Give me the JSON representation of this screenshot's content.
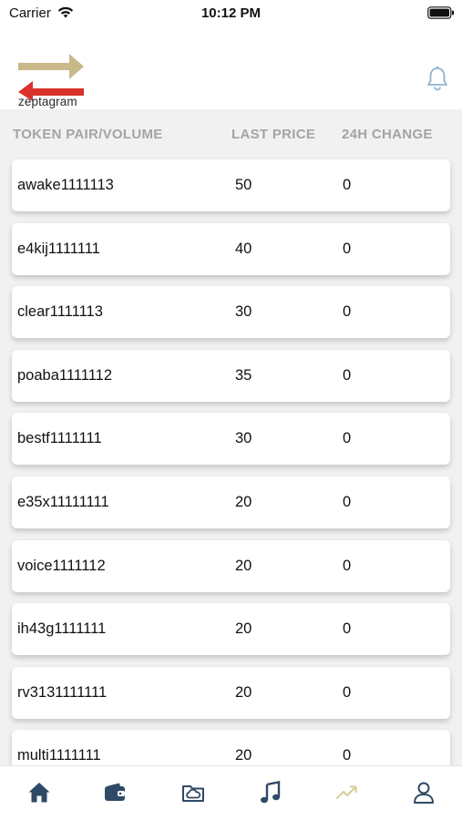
{
  "status_bar": {
    "carrier": "Carrier",
    "time": "10:12 PM"
  },
  "header": {
    "logo_text": "zeptagram"
  },
  "table": {
    "headers": {
      "pair": "TOKEN PAIR/VOLUME",
      "price": "LAST PRICE",
      "change": "24H CHANGE"
    },
    "rows": [
      {
        "pair": "awake1111113",
        "price": "50",
        "change": "0"
      },
      {
        "pair": "e4kij1111111",
        "price": "40",
        "change": "0"
      },
      {
        "pair": "clear1111113",
        "price": "30",
        "change": "0"
      },
      {
        "pair": "poaba1111112",
        "price": "35",
        "change": "0"
      },
      {
        "pair": "bestf1111111",
        "price": "30",
        "change": "0"
      },
      {
        "pair": "e35x11111111",
        "price": "20",
        "change": "0"
      },
      {
        "pair": "voice1111112",
        "price": "20",
        "change": "0"
      },
      {
        "pair": "ih43g1111111",
        "price": "20",
        "change": "0"
      },
      {
        "pair": "rv3131111111",
        "price": "20",
        "change": "0"
      },
      {
        "pair": "multi1111111",
        "price": "20",
        "change": "0"
      }
    ]
  },
  "tab_bar": {
    "tabs": [
      {
        "icon": "home-icon"
      },
      {
        "icon": "wallet-icon"
      },
      {
        "icon": "cloud-folder-icon"
      },
      {
        "icon": "music-note-icon"
      },
      {
        "icon": "trending-icon",
        "active": true
      },
      {
        "icon": "profile-icon"
      }
    ]
  },
  "colors": {
    "header_text": "#a4a4a4",
    "tab_icon": "#2f4a66",
    "tab_active": "#d8cc9a",
    "logo_gold": "#c9b88a",
    "logo_red": "#d9312b",
    "bell": "#8fb3cf"
  }
}
